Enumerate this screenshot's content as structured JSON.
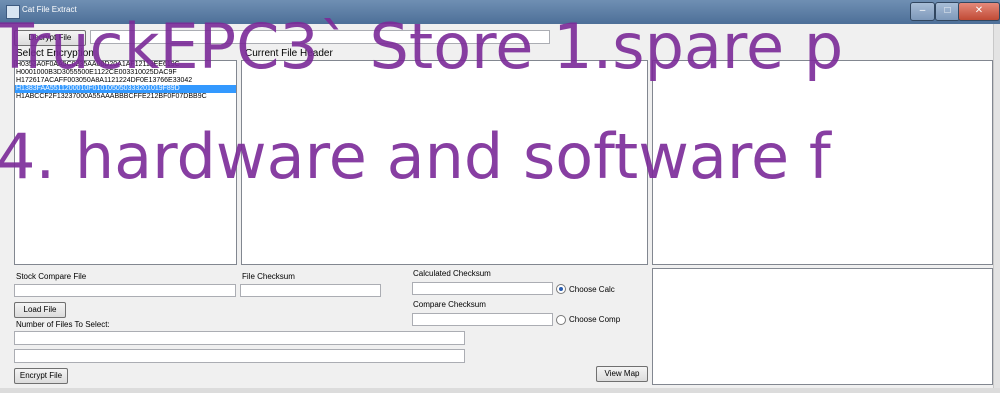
{
  "window": {
    "title": "Cat File Extract",
    "minimize": "–",
    "maximize": "□",
    "close": "✕"
  },
  "buttons": {
    "decrypt": "Decrypt File",
    "load": "Load File",
    "encrypt": "Encrypt File",
    "view_map": "View Map"
  },
  "labels": {
    "select_encryption": "Select Encryption",
    "current_file_header": "Current File Header",
    "stock_compare_file": "Stock Compare File",
    "file_checksum": "File Checksum",
    "calculated_checksum": "Calculated Checksum",
    "compare_checksum": "Compare Checksum",
    "number_of_files": "Number of Files To Select:",
    "choose_calc": "Choose Calc",
    "choose_comp": "Choose Comp"
  },
  "encryption_list": [
    "H0353A0F0AA5C0235AA00D20A1AF12113EE619C",
    "H0001000B3D3055500E1122CE003310025DAC9F",
    "H172617ACAFF003050A8A1121224DF0E13766E33042",
    "H1383FAA5511200010F010105050333201019F89D",
    "H1ABCCF2F13237000A55AAABBBCFFE212BF0F07DBB9C"
  ],
  "selected_index": 3,
  "radios": {
    "calc_checked": true,
    "comp_checked": false
  },
  "watermark": {
    "line1": "TruckEPC3` Store  1.spare p",
    "line2": "4. hardware and software f"
  },
  "colors": {
    "watermark": "#7b2a98",
    "selection": "#3399ff"
  }
}
